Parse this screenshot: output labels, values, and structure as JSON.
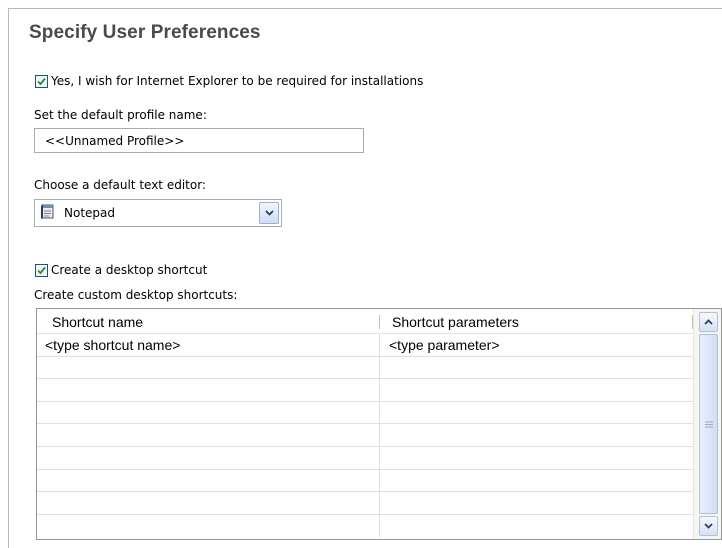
{
  "page": {
    "title": "Specify User Preferences"
  },
  "ie_required": {
    "checked": true,
    "label": "Yes, I wish for Internet Explorer to be required for installations"
  },
  "profile": {
    "label": "Set the default profile name:",
    "value": "<<Unnamed Profile>>"
  },
  "editor": {
    "label": "Choose a default text editor:",
    "selected": "Notepad",
    "icon": "notepad-icon"
  },
  "desktop_shortcut": {
    "checked": true,
    "label": "Create a desktop shortcut"
  },
  "custom_shortcuts": {
    "label": "Create custom desktop shortcuts:",
    "columns": [
      "Shortcut name",
      "Shortcut parameters"
    ],
    "rows": [
      [
        "<type shortcut name>",
        "<type parameter>"
      ],
      [
        "",
        ""
      ],
      [
        "",
        ""
      ],
      [
        "",
        ""
      ],
      [
        "",
        ""
      ],
      [
        "",
        ""
      ],
      [
        "",
        ""
      ],
      [
        "",
        ""
      ],
      [
        "",
        ""
      ]
    ]
  },
  "colors": {
    "title": "#4a4a4a",
    "check": "#2b8a2b",
    "control_border": "#a5acb5"
  }
}
